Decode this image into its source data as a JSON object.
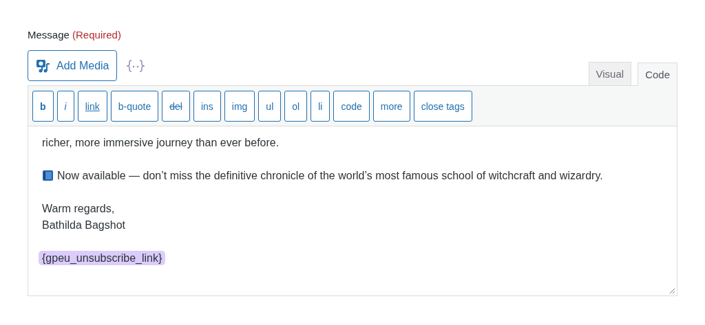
{
  "field": {
    "label": "Message",
    "required": "(Required)"
  },
  "add_media": {
    "label": "Add Media"
  },
  "tabs": [
    {
      "label": "Visual",
      "selected": false
    },
    {
      "label": "Code",
      "selected": true
    }
  ],
  "toolbar": [
    {
      "label": "b",
      "kind": "bold"
    },
    {
      "label": "i",
      "kind": "italic"
    },
    {
      "label": "link",
      "kind": "underline"
    },
    {
      "label": "b-quote",
      "kind": "plain"
    },
    {
      "label": "del",
      "kind": "strike"
    },
    {
      "label": "ins",
      "kind": "plain"
    },
    {
      "label": "img",
      "kind": "plain"
    },
    {
      "label": "ul",
      "kind": "plain"
    },
    {
      "label": "ol",
      "kind": "plain"
    },
    {
      "label": "li",
      "kind": "plain"
    },
    {
      "label": "code",
      "kind": "plain"
    },
    {
      "label": "more",
      "kind": "plain"
    },
    {
      "label": "close tags",
      "kind": "plain"
    }
  ],
  "content": [
    {
      "kind": "text",
      "text": "richer, more immersive journey than ever before."
    },
    {
      "kind": "book",
      "text": "Now available — don’t miss the definitive chronicle of the world’s most famous school of witchcraft and wizardry."
    },
    {
      "kind": "lines",
      "lines": [
        "Warm regards,",
        "Bathilda Bagshot"
      ]
    },
    {
      "kind": "token",
      "text": "{gpeu_unsubscribe_link}"
    }
  ]
}
